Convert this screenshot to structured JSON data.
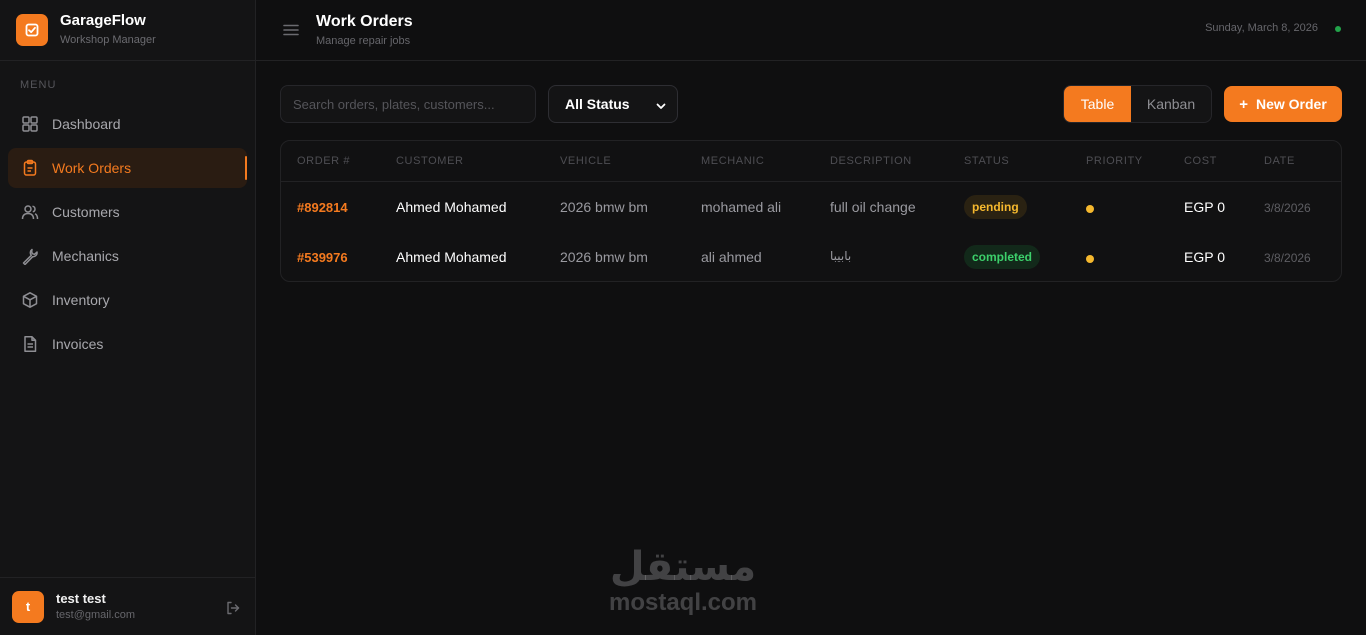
{
  "brand": {
    "title": "GarageFlow",
    "subtitle": "Workshop Manager"
  },
  "sidebar": {
    "menu_label": "MENU",
    "items": [
      {
        "label": "Dashboard",
        "icon": "grid-icon",
        "active": false
      },
      {
        "label": "Work Orders",
        "icon": "clipboard-icon",
        "active": true
      },
      {
        "label": "Customers",
        "icon": "users-icon",
        "active": false
      },
      {
        "label": "Mechanics",
        "icon": "wrench-icon",
        "active": false
      },
      {
        "label": "Inventory",
        "icon": "box-icon",
        "active": false
      },
      {
        "label": "Invoices",
        "icon": "file-icon",
        "active": false
      }
    ]
  },
  "user": {
    "initial": "t",
    "name": "test test",
    "email": "test@gmail.com"
  },
  "header": {
    "title": "Work Orders",
    "subtitle": "Manage repair jobs",
    "date": "Sunday, March 8, 2026"
  },
  "toolbar": {
    "search_placeholder": "Search orders, plates, customers...",
    "status_filter": "All Status",
    "view_table": "Table",
    "view_kanban": "Kanban",
    "new_order": "New Order"
  },
  "table": {
    "columns": [
      "ORDER #",
      "CUSTOMER",
      "VEHICLE",
      "MECHANIC",
      "DESCRIPTION",
      "STATUS",
      "PRIORITY",
      "COST",
      "DATE"
    ],
    "rows": [
      {
        "order": "#892814",
        "customer": "Ahmed Mohamed",
        "vehicle": "2026 bmw bm",
        "mechanic": "mohamed ali",
        "description": "full oil change",
        "status": "pending",
        "cost": "EGP 0",
        "date": "3/8/2026"
      },
      {
        "order": "#539976",
        "customer": "Ahmed Mohamed",
        "vehicle": "2026 bmw bm",
        "mechanic": "ali ahmed",
        "description": "بابيبا",
        "status": "completed",
        "cost": "EGP 0",
        "date": "3/8/2026"
      }
    ]
  },
  "watermark": {
    "arabic": "مستقل",
    "latin": "mostaql.com"
  },
  "colors": {
    "accent": "#f47a1f",
    "pending": "#f5b82e",
    "completed": "#3ccf6b",
    "background": "#0f0f10"
  }
}
